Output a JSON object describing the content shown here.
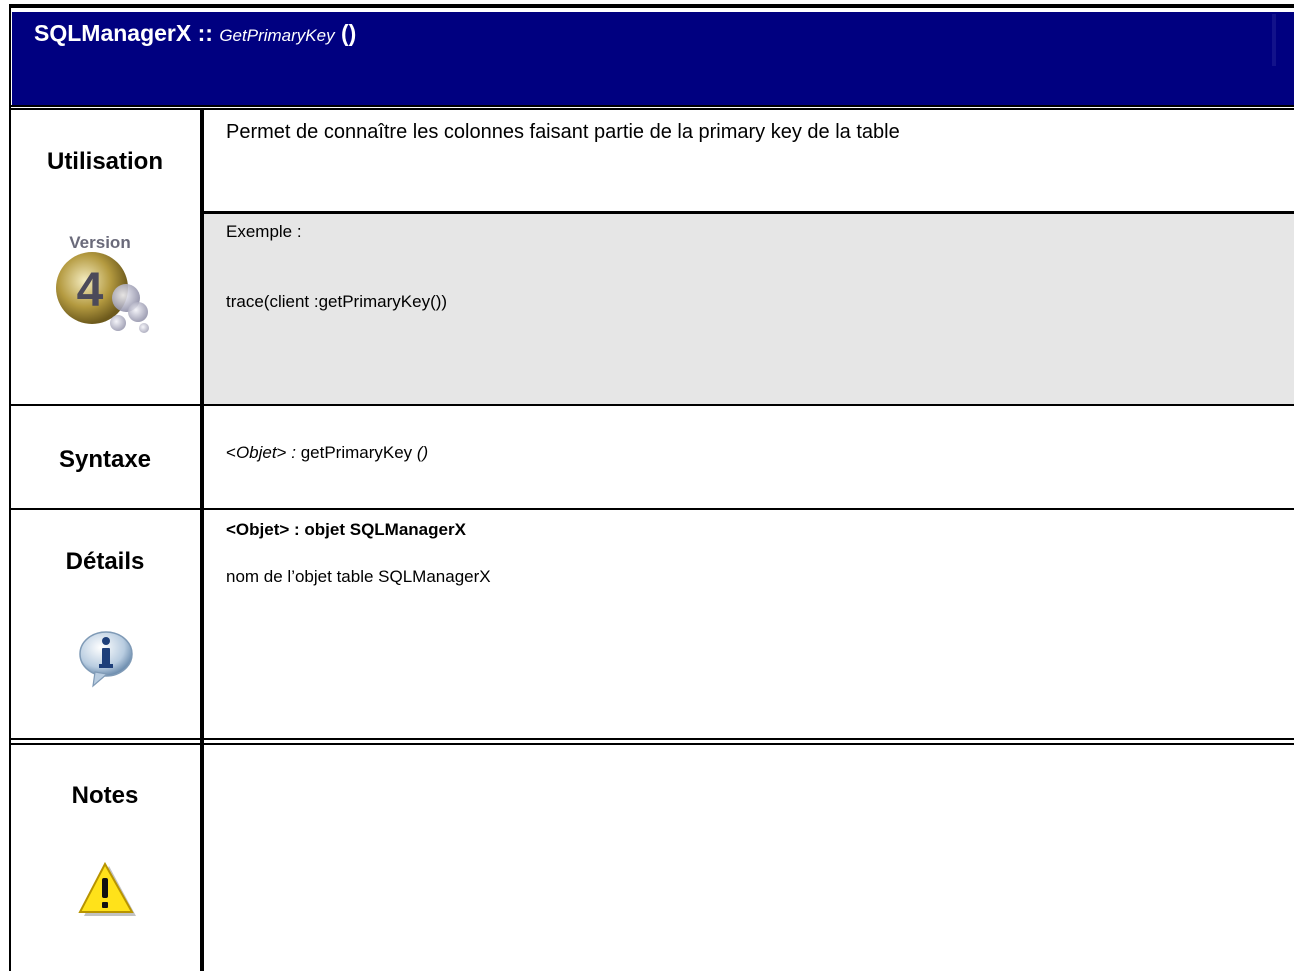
{
  "header": {
    "class_name": "SQLManagerX",
    "separator": "::",
    "method": "GetPrimaryKey",
    "parens": "()"
  },
  "rows": {
    "utilisation": {
      "label": "Utilisation",
      "badge": "Version",
      "badge_digit": "4",
      "description": "Permet de connaître les colonnes faisant partie de la primary key de la table",
      "example_title": "Exemple :",
      "example_code": "trace(client :getPrimaryKey())"
    },
    "syntaxe": {
      "label": "Syntaxe",
      "obj_open": "<",
      "obj": "Objet",
      "obj_close": ">",
      "colon": " : ",
      "method": "getPrimaryKey",
      "parens": " ()"
    },
    "details": {
      "label": "Détails",
      "param_title": "<Objet> : objet SQLManagerX",
      "param_desc": "nom de l’objet table SQLManagerX",
      "icon": "info-icon"
    },
    "notes": {
      "label": "Notes",
      "icon": "warning-icon"
    }
  },
  "colors": {
    "header_bg": "#000080",
    "example_bg": "#e6e6e6",
    "lines": "#000000"
  }
}
